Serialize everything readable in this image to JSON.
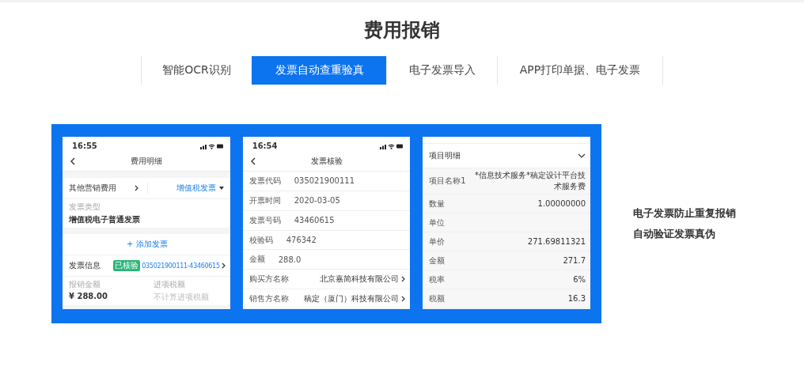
{
  "title": "费用报销",
  "tabs": [
    {
      "label": "智能OCR识别",
      "selected": false
    },
    {
      "label": "发票自动查重验真",
      "selected": true
    },
    {
      "label": "电子发票导入",
      "selected": false
    },
    {
      "label": "APP打印单据、电子发票",
      "selected": false
    }
  ],
  "phones": [
    {
      "kind": "expense_detail",
      "time": "16:55",
      "header": "费用明细",
      "category": "其他营销费用",
      "invoice_type_choice": "增值税发票",
      "type_label": "发票类型",
      "type_value": "增值税电子普通发票",
      "add_button": "+ 添加发票",
      "info_label": "发票信息",
      "badge": "已核验",
      "invoice_number": "035021900111-43460615",
      "amount_label": "报销金额",
      "amount_value": "¥  288.00",
      "tax_label": "进项税额",
      "tax_placeholder": "不计算进项税额"
    },
    {
      "kind": "invoice_check",
      "time": "16:54",
      "header": "发票核验",
      "fields": [
        {
          "label": "发票代码",
          "value": "035021900111",
          "link": false
        },
        {
          "label": "开票时间",
          "value": "2020-03-05",
          "link": false
        },
        {
          "label": "发票号码",
          "value": "43460615",
          "link": false
        },
        {
          "label": "校验码",
          "value": "476342",
          "link": false
        },
        {
          "label": "金额",
          "value": "288.0",
          "link": false
        },
        {
          "label": "购买方名称",
          "value": "北京嘉简科技有限公司",
          "link": true
        },
        {
          "label": "销售方名称",
          "value": "稿定（厦门）科技有限公司",
          "link": true
        }
      ]
    },
    {
      "kind": "item_detail",
      "section": "项目明细",
      "fields": [
        {
          "label": "项目名称1",
          "value": "*信息技术服务*稿定设计平台技术服务费"
        },
        {
          "label": "数量",
          "value": "1.00000000"
        },
        {
          "label": "单位"
        },
        {
          "label": "单价",
          "value": "271.69811321"
        },
        {
          "label": "金额",
          "value": "271.7"
        },
        {
          "label": "税率",
          "value": "6%"
        },
        {
          "label": "税额",
          "value": "16.3"
        }
      ]
    }
  ],
  "captions": [
    "电子发票防止重复报销",
    "自动验证发票真伪"
  ]
}
